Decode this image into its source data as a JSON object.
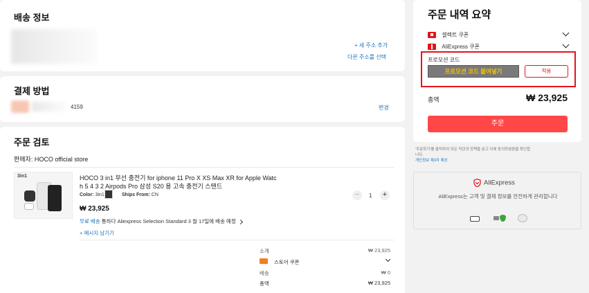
{
  "shipping": {
    "title": "배송 정보",
    "add_address": "+ 새 주소 추가",
    "select_address": "다른 주소를 선택"
  },
  "payment": {
    "title": "결제 방법",
    "card_last4": "4159",
    "change": "변경"
  },
  "review": {
    "title": "주문 검토",
    "seller": "판매자: HOCO official store",
    "product": {
      "badge": "3in1",
      "name_line1": "HOCO 3 in1 무선 충전기 for iphone 11 Pro X XS Max XR for Apple Watc",
      "name_line2": "h 5 4 3 2 Airpods Pro 삼성 S20 용 고속 충전기 스탠드",
      "color_label": "Color:",
      "color_value": "3in1",
      "ships_label": "Ships From:",
      "ships_value": "CN",
      "price": "₩ 23,925",
      "quantity": "1",
      "shipping_free": "무료 배송",
      "shipping_info": "통하다 Aliexpress Selection Standard 3 월 17일에 배송 예정",
      "message_seller": "+ 메시지 남기기"
    },
    "totals": {
      "subtotal_label": "소계",
      "subtotal_value": "₩ 23,925",
      "store_coupon_label": "스토어 쿠폰",
      "shipping_label": "배송",
      "shipping_value": "₩ 0",
      "total_label": "총액",
      "total_value": "₩ 23,925"
    }
  },
  "summary": {
    "title": "주문 내역 요약",
    "coupon_select": "셀렉트 쿠폰",
    "coupon_aliexpress": "AliExpress 쿠폰",
    "promo_label": "프로모션 코드",
    "promo_placeholder": "프로모션 코드 붙여넣기",
    "apply": "적용",
    "total_label": "총액",
    "total_value": "₩ 23,925",
    "order_button": "주문",
    "terms_line1": "'주문하기'를 클릭하여 모든 약관과 정책을 읽고 이에 동의하였음을 확인합",
    "terms_line2": "니다.",
    "terms_line3": "개인정보 제3자 제공"
  },
  "trust": {
    "brand": "AliExpress",
    "message": "AliExpress는 고객 및 결제 정보를 안전하게 관리합니다"
  },
  "colors": {
    "accent": "#ff4747",
    "highlight": "#e3141b",
    "promo_fill": "#7a7a7a",
    "promo_text": "#f5c400",
    "link": "#1e73be"
  }
}
